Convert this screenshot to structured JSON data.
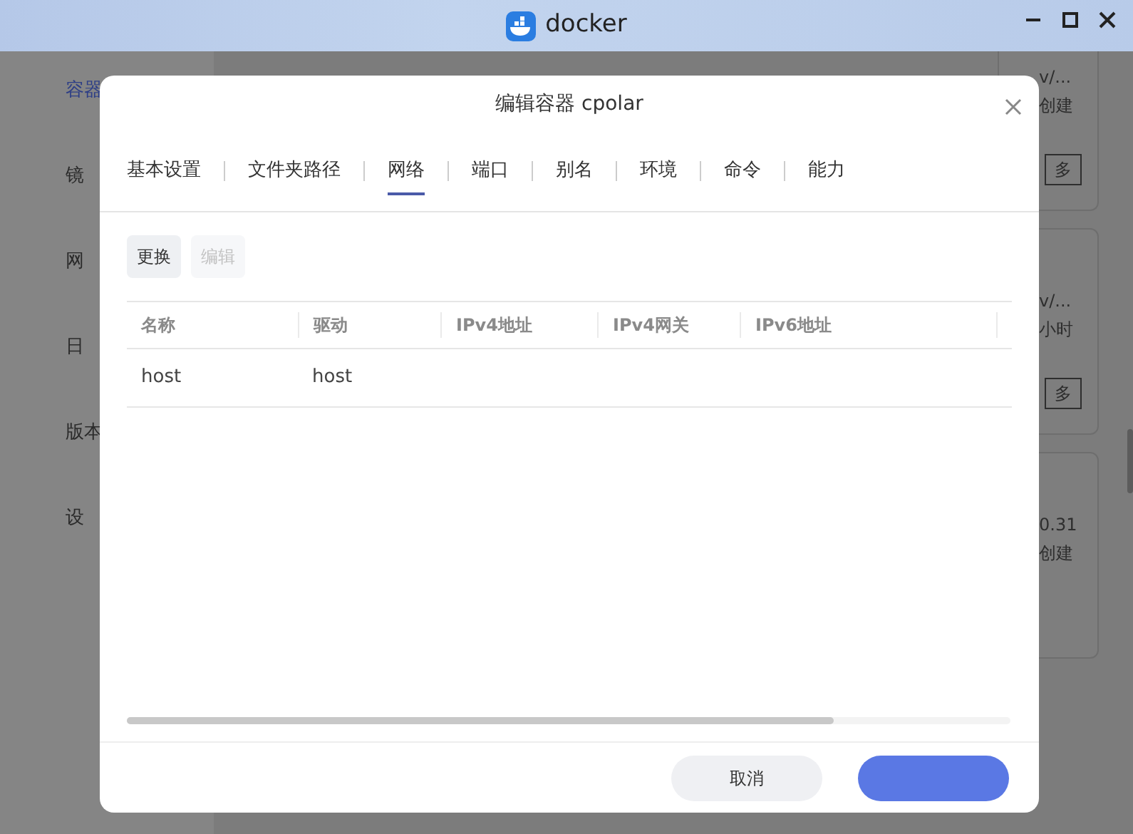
{
  "window": {
    "title": "docker"
  },
  "sidebar": {
    "items": [
      {
        "label": "容器",
        "selected": true
      },
      {
        "label": "镜",
        "selected": false
      },
      {
        "label": "网",
        "selected": false
      },
      {
        "label": "日",
        "selected": false
      },
      {
        "label": "版本",
        "selected": false
      },
      {
        "label": "设",
        "selected": false
      }
    ]
  },
  "cards": [
    {
      "lines": [
        "v/...",
        "创建"
      ],
      "button": "多"
    },
    {
      "lines": [
        "v/...",
        "小时"
      ],
      "button": "多"
    },
    {
      "lines": [
        "0.31",
        "创建"
      ]
    }
  ],
  "dialog": {
    "title": "编辑容器 cpolar",
    "tabs": [
      {
        "label": "基本设置",
        "selected": false
      },
      {
        "label": "文件夹路径",
        "selected": false
      },
      {
        "label": "网络",
        "selected": true
      },
      {
        "label": "端口",
        "selected": false
      },
      {
        "label": "别名",
        "selected": false
      },
      {
        "label": "环境",
        "selected": false
      },
      {
        "label": "命令",
        "selected": false
      },
      {
        "label": "能力",
        "selected": false
      }
    ],
    "toolbar": [
      {
        "label": "更换",
        "disabled": false
      },
      {
        "label": "编辑",
        "disabled": true
      }
    ],
    "table": {
      "columns": [
        "名称",
        "驱动",
        "IPv4地址",
        "IPv4网关",
        "IPv6地址"
      ],
      "rows": [
        [
          "host",
          "host",
          "",
          "",
          ""
        ]
      ]
    },
    "buttons": [
      {
        "label": "取消",
        "kind": "secondary"
      },
      {
        "kind": "primary"
      }
    ]
  }
}
